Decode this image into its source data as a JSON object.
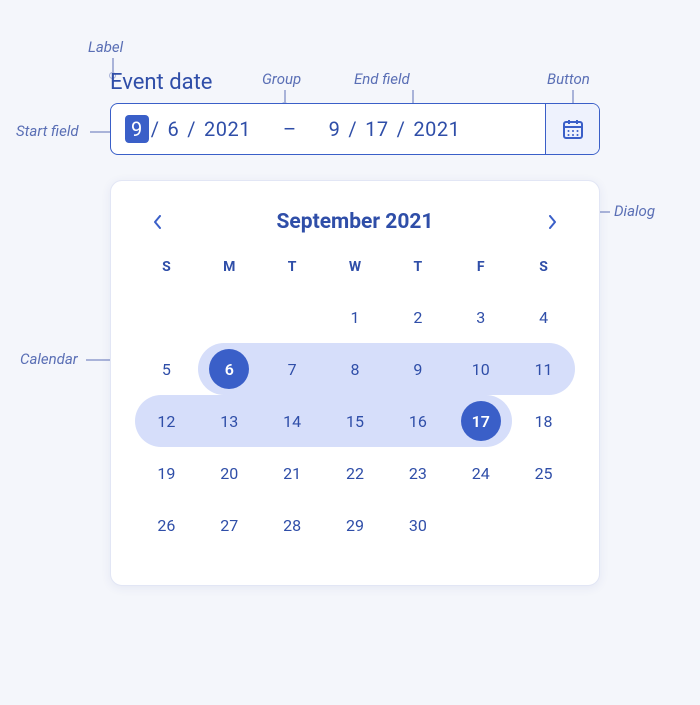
{
  "annotations": {
    "label": "Label",
    "group": "Group",
    "end_field": "End field",
    "button": "Button",
    "start_field": "Start field",
    "dialog": "Dialog",
    "calendar": "Calendar"
  },
  "picker": {
    "label": "Event date",
    "start": {
      "month": "9",
      "day": "6",
      "year": "2021"
    },
    "end": {
      "month": "9",
      "day": "17",
      "year": "2021"
    },
    "sep": "/",
    "range_sep": "–"
  },
  "calendar": {
    "title": "September 2021",
    "prev_icon": "chevron-left-icon",
    "next_icon": "chevron-right-icon",
    "dow": [
      "S",
      "M",
      "T",
      "W",
      "T",
      "F",
      "S"
    ],
    "leading_blanks": 3,
    "days_in_month": 30,
    "range_start": 6,
    "range_end": 17
  }
}
